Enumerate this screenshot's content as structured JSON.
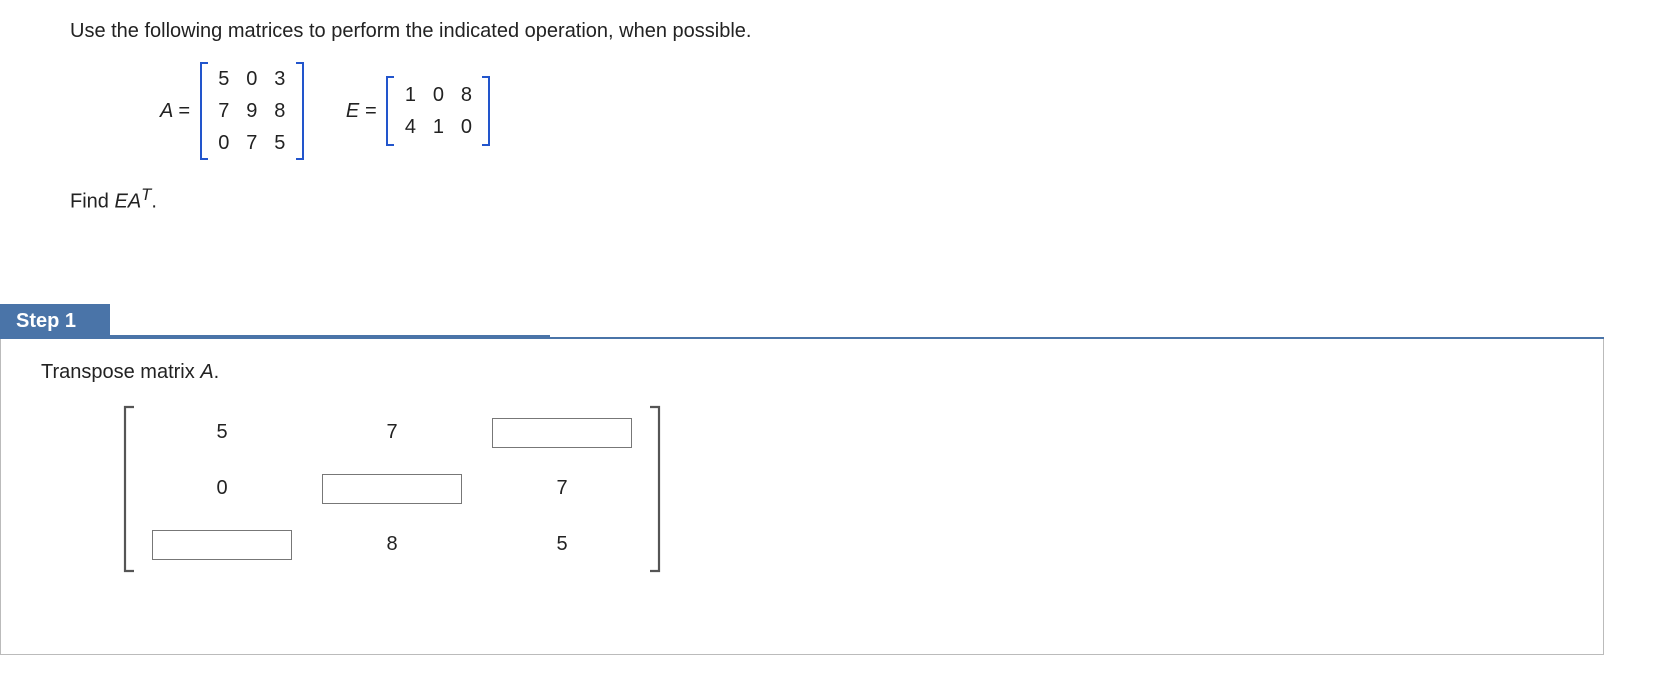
{
  "prompt": "Use the following matrices to perform the indicated operation, when possible.",
  "matrixA": {
    "label": "A =",
    "rows": [
      [
        "5",
        "0",
        "3"
      ],
      [
        "7",
        "9",
        "8"
      ],
      [
        "0",
        "7",
        "5"
      ]
    ]
  },
  "matrixE": {
    "label": "E =",
    "rows": [
      [
        "1",
        "0",
        "8"
      ],
      [
        "4",
        "1",
        "0"
      ]
    ]
  },
  "find": {
    "prefix": "Find ",
    "expr_E": "E",
    "expr_A": "A",
    "sup": "T",
    "period": "."
  },
  "step": {
    "tab": "Step 1",
    "instruction_pre": "Transpose matrix ",
    "instruction_mat": "A",
    "instruction_post": "."
  },
  "transposeGrid": [
    [
      {
        "type": "text",
        "val": "5"
      },
      {
        "type": "text",
        "val": "7"
      },
      {
        "type": "input",
        "val": ""
      }
    ],
    [
      {
        "type": "text",
        "val": "0"
      },
      {
        "type": "input",
        "val": ""
      },
      {
        "type": "text",
        "val": "7"
      }
    ],
    [
      {
        "type": "input",
        "val": ""
      },
      {
        "type": "text",
        "val": "8"
      },
      {
        "type": "text",
        "val": "5"
      }
    ]
  ]
}
